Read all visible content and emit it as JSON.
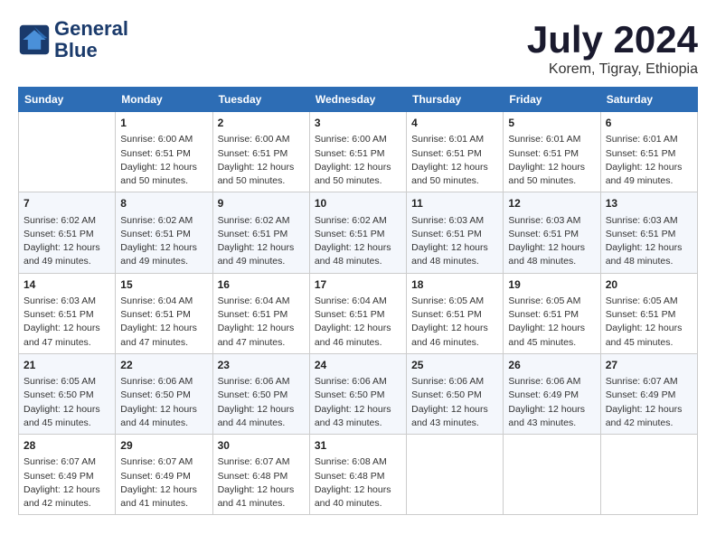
{
  "logo": {
    "line1": "General",
    "line2": "Blue"
  },
  "title": "July 2024",
  "subtitle": "Korem, Tigray, Ethiopia",
  "days_header": [
    "Sunday",
    "Monday",
    "Tuesday",
    "Wednesday",
    "Thursday",
    "Friday",
    "Saturday"
  ],
  "weeks": [
    [
      {
        "day": "",
        "info": ""
      },
      {
        "day": "1",
        "info": "Sunrise: 6:00 AM\nSunset: 6:51 PM\nDaylight: 12 hours\nand 50 minutes."
      },
      {
        "day": "2",
        "info": "Sunrise: 6:00 AM\nSunset: 6:51 PM\nDaylight: 12 hours\nand 50 minutes."
      },
      {
        "day": "3",
        "info": "Sunrise: 6:00 AM\nSunset: 6:51 PM\nDaylight: 12 hours\nand 50 minutes."
      },
      {
        "day": "4",
        "info": "Sunrise: 6:01 AM\nSunset: 6:51 PM\nDaylight: 12 hours\nand 50 minutes."
      },
      {
        "day": "5",
        "info": "Sunrise: 6:01 AM\nSunset: 6:51 PM\nDaylight: 12 hours\nand 50 minutes."
      },
      {
        "day": "6",
        "info": "Sunrise: 6:01 AM\nSunset: 6:51 PM\nDaylight: 12 hours\nand 49 minutes."
      }
    ],
    [
      {
        "day": "7",
        "info": "Sunrise: 6:02 AM\nSunset: 6:51 PM\nDaylight: 12 hours\nand 49 minutes."
      },
      {
        "day": "8",
        "info": "Sunrise: 6:02 AM\nSunset: 6:51 PM\nDaylight: 12 hours\nand 49 minutes."
      },
      {
        "day": "9",
        "info": "Sunrise: 6:02 AM\nSunset: 6:51 PM\nDaylight: 12 hours\nand 49 minutes."
      },
      {
        "day": "10",
        "info": "Sunrise: 6:02 AM\nSunset: 6:51 PM\nDaylight: 12 hours\nand 48 minutes."
      },
      {
        "day": "11",
        "info": "Sunrise: 6:03 AM\nSunset: 6:51 PM\nDaylight: 12 hours\nand 48 minutes."
      },
      {
        "day": "12",
        "info": "Sunrise: 6:03 AM\nSunset: 6:51 PM\nDaylight: 12 hours\nand 48 minutes."
      },
      {
        "day": "13",
        "info": "Sunrise: 6:03 AM\nSunset: 6:51 PM\nDaylight: 12 hours\nand 48 minutes."
      }
    ],
    [
      {
        "day": "14",
        "info": "Sunrise: 6:03 AM\nSunset: 6:51 PM\nDaylight: 12 hours\nand 47 minutes."
      },
      {
        "day": "15",
        "info": "Sunrise: 6:04 AM\nSunset: 6:51 PM\nDaylight: 12 hours\nand 47 minutes."
      },
      {
        "day": "16",
        "info": "Sunrise: 6:04 AM\nSunset: 6:51 PM\nDaylight: 12 hours\nand 47 minutes."
      },
      {
        "day": "17",
        "info": "Sunrise: 6:04 AM\nSunset: 6:51 PM\nDaylight: 12 hours\nand 46 minutes."
      },
      {
        "day": "18",
        "info": "Sunrise: 6:05 AM\nSunset: 6:51 PM\nDaylight: 12 hours\nand 46 minutes."
      },
      {
        "day": "19",
        "info": "Sunrise: 6:05 AM\nSunset: 6:51 PM\nDaylight: 12 hours\nand 45 minutes."
      },
      {
        "day": "20",
        "info": "Sunrise: 6:05 AM\nSunset: 6:51 PM\nDaylight: 12 hours\nand 45 minutes."
      }
    ],
    [
      {
        "day": "21",
        "info": "Sunrise: 6:05 AM\nSunset: 6:50 PM\nDaylight: 12 hours\nand 45 minutes."
      },
      {
        "day": "22",
        "info": "Sunrise: 6:06 AM\nSunset: 6:50 PM\nDaylight: 12 hours\nand 44 minutes."
      },
      {
        "day": "23",
        "info": "Sunrise: 6:06 AM\nSunset: 6:50 PM\nDaylight: 12 hours\nand 44 minutes."
      },
      {
        "day": "24",
        "info": "Sunrise: 6:06 AM\nSunset: 6:50 PM\nDaylight: 12 hours\nand 43 minutes."
      },
      {
        "day": "25",
        "info": "Sunrise: 6:06 AM\nSunset: 6:50 PM\nDaylight: 12 hours\nand 43 minutes."
      },
      {
        "day": "26",
        "info": "Sunrise: 6:06 AM\nSunset: 6:49 PM\nDaylight: 12 hours\nand 43 minutes."
      },
      {
        "day": "27",
        "info": "Sunrise: 6:07 AM\nSunset: 6:49 PM\nDaylight: 12 hours\nand 42 minutes."
      }
    ],
    [
      {
        "day": "28",
        "info": "Sunrise: 6:07 AM\nSunset: 6:49 PM\nDaylight: 12 hours\nand 42 minutes."
      },
      {
        "day": "29",
        "info": "Sunrise: 6:07 AM\nSunset: 6:49 PM\nDaylight: 12 hours\nand 41 minutes."
      },
      {
        "day": "30",
        "info": "Sunrise: 6:07 AM\nSunset: 6:48 PM\nDaylight: 12 hours\nand 41 minutes."
      },
      {
        "day": "31",
        "info": "Sunrise: 6:08 AM\nSunset: 6:48 PM\nDaylight: 12 hours\nand 40 minutes."
      },
      {
        "day": "",
        "info": ""
      },
      {
        "day": "",
        "info": ""
      },
      {
        "day": "",
        "info": ""
      }
    ]
  ]
}
